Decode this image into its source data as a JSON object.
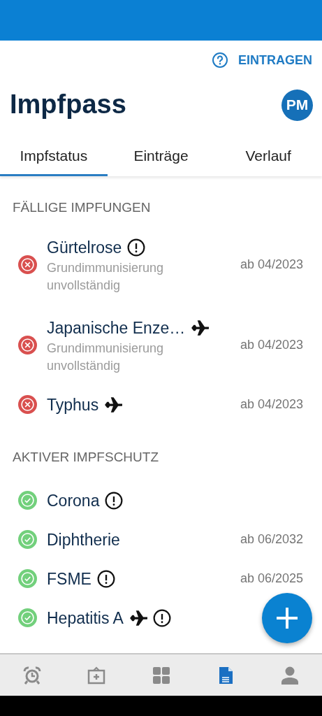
{
  "header": {
    "help_action": "EINTRAGEN",
    "title": "Impfpass",
    "avatar": "PM"
  },
  "tabs": [
    {
      "label": "Impfstatus",
      "selected": true
    },
    {
      "label": "Einträge",
      "selected": false
    },
    {
      "label": "Verlauf",
      "selected": false
    }
  ],
  "sections": [
    {
      "title": "FÄLLIGE IMPFUNGEN",
      "items": [
        {
          "kind": "due",
          "name": "Gürtelrose",
          "icons": [
            {
              "kind": "warning"
            }
          ],
          "note": "Grundimmunisierung unvollständig",
          "date": "ab 04/2023"
        },
        {
          "kind": "due",
          "name": "Japanische Enze…",
          "icons": [
            {
              "kind": "travel"
            }
          ],
          "note": "Grundimmunisierung unvollständig",
          "date": "ab 04/2023"
        },
        {
          "kind": "due",
          "name": "Typhus",
          "icons": [
            {
              "kind": "travel"
            }
          ],
          "date": "ab 04/2023"
        }
      ]
    },
    {
      "title": "AKTIVER IMPFSCHUTZ",
      "items": [
        {
          "kind": "active",
          "name": "Corona",
          "icons": [
            {
              "kind": "warning"
            }
          ]
        },
        {
          "kind": "active",
          "name": "Diphtherie",
          "date": "ab 06/2032"
        },
        {
          "kind": "active",
          "name": "FSME",
          "icons": [
            {
              "kind": "warning"
            }
          ],
          "date": "ab 06/2025"
        },
        {
          "kind": "active",
          "name": "Hepatitis A",
          "icons": [
            {
              "kind": "travel"
            },
            {
              "kind": "warning"
            }
          ]
        }
      ]
    }
  ],
  "bottom_nav": [
    {
      "kind": "reminders",
      "selected": false
    },
    {
      "kind": "medical",
      "selected": false
    },
    {
      "kind": "dashboard",
      "selected": false
    },
    {
      "kind": "documents",
      "selected": true
    },
    {
      "kind": "profile",
      "selected": false
    }
  ]
}
